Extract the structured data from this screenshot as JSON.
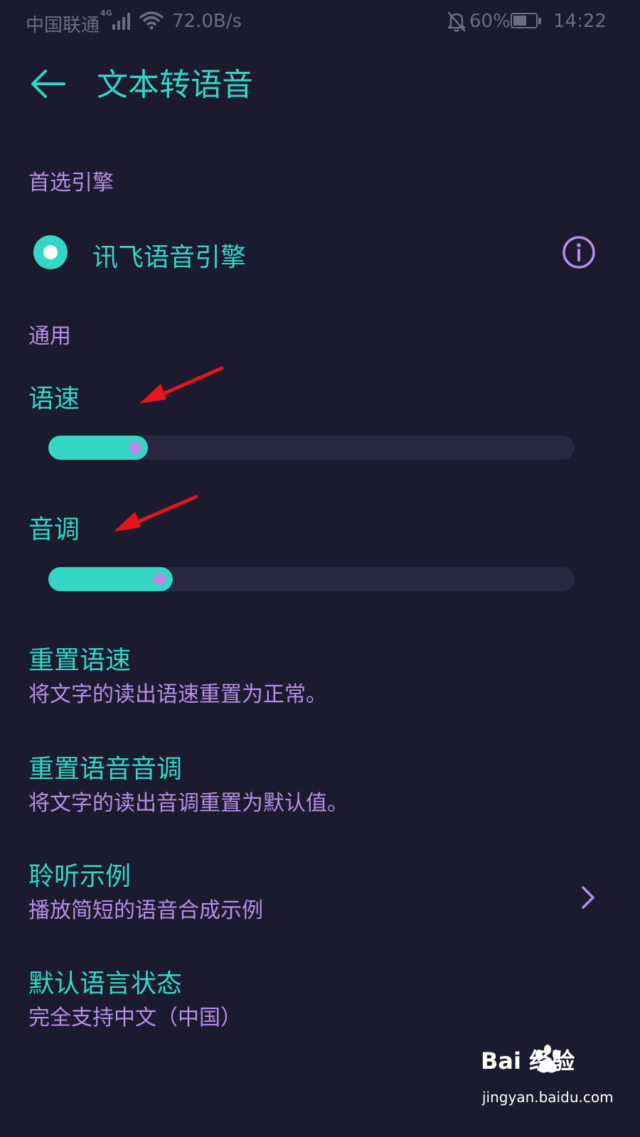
{
  "status_bar": {
    "carrier": "中国联通",
    "network_type": "4G",
    "net_speed": "72.0B/s",
    "battery_percent": "60%",
    "battery_level": 0.6,
    "time": "14:22"
  },
  "header": {
    "title": "文本转语音"
  },
  "engine_section": {
    "header": "首选引擎",
    "engine_label": "讯飞语音引擎",
    "selected": true
  },
  "general_section": {
    "header": "通用"
  },
  "speech_rate": {
    "label": "语速",
    "value_fraction": 0.15
  },
  "pitch": {
    "label": "音调",
    "value_fraction": 0.2
  },
  "settings": [
    {
      "title": "重置语速",
      "description": "将文字的读出语速重置为正常。"
    },
    {
      "title": "重置语音音调",
      "description": "将文字的读出音调重置为默认值。"
    },
    {
      "title": "聆听示例",
      "description": "播放简短的语音合成示例"
    },
    {
      "title": "默认语言状态",
      "description": "完全支持中文（中国）"
    }
  ],
  "watermark": {
    "brand": "Bai 经验",
    "url": "jingyan.baidu.com"
  },
  "colors": {
    "background": "#1b1a2e",
    "accent_teal": "#34d6c6",
    "accent_purple": "#b58fe6",
    "track": "#2a2840",
    "annotation_red": "#e8141c"
  }
}
